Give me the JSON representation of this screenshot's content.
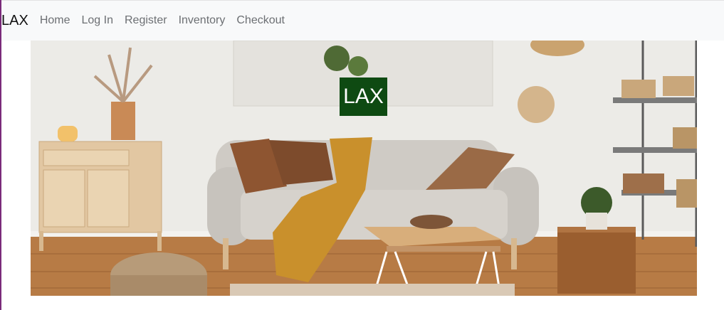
{
  "navbar": {
    "brand": "LAX",
    "links": [
      "Home",
      "Log In",
      "Register",
      "Inventory",
      "Checkout"
    ]
  },
  "hero": {
    "badge_text": "LAX",
    "image_subject": "living room with sofa, wooden cabinet, shelves and coffee table",
    "badge_color": "#0e4a12"
  },
  "colors": {
    "navbar_bg": "#f8f9fa",
    "link": "#6c6f73"
  }
}
